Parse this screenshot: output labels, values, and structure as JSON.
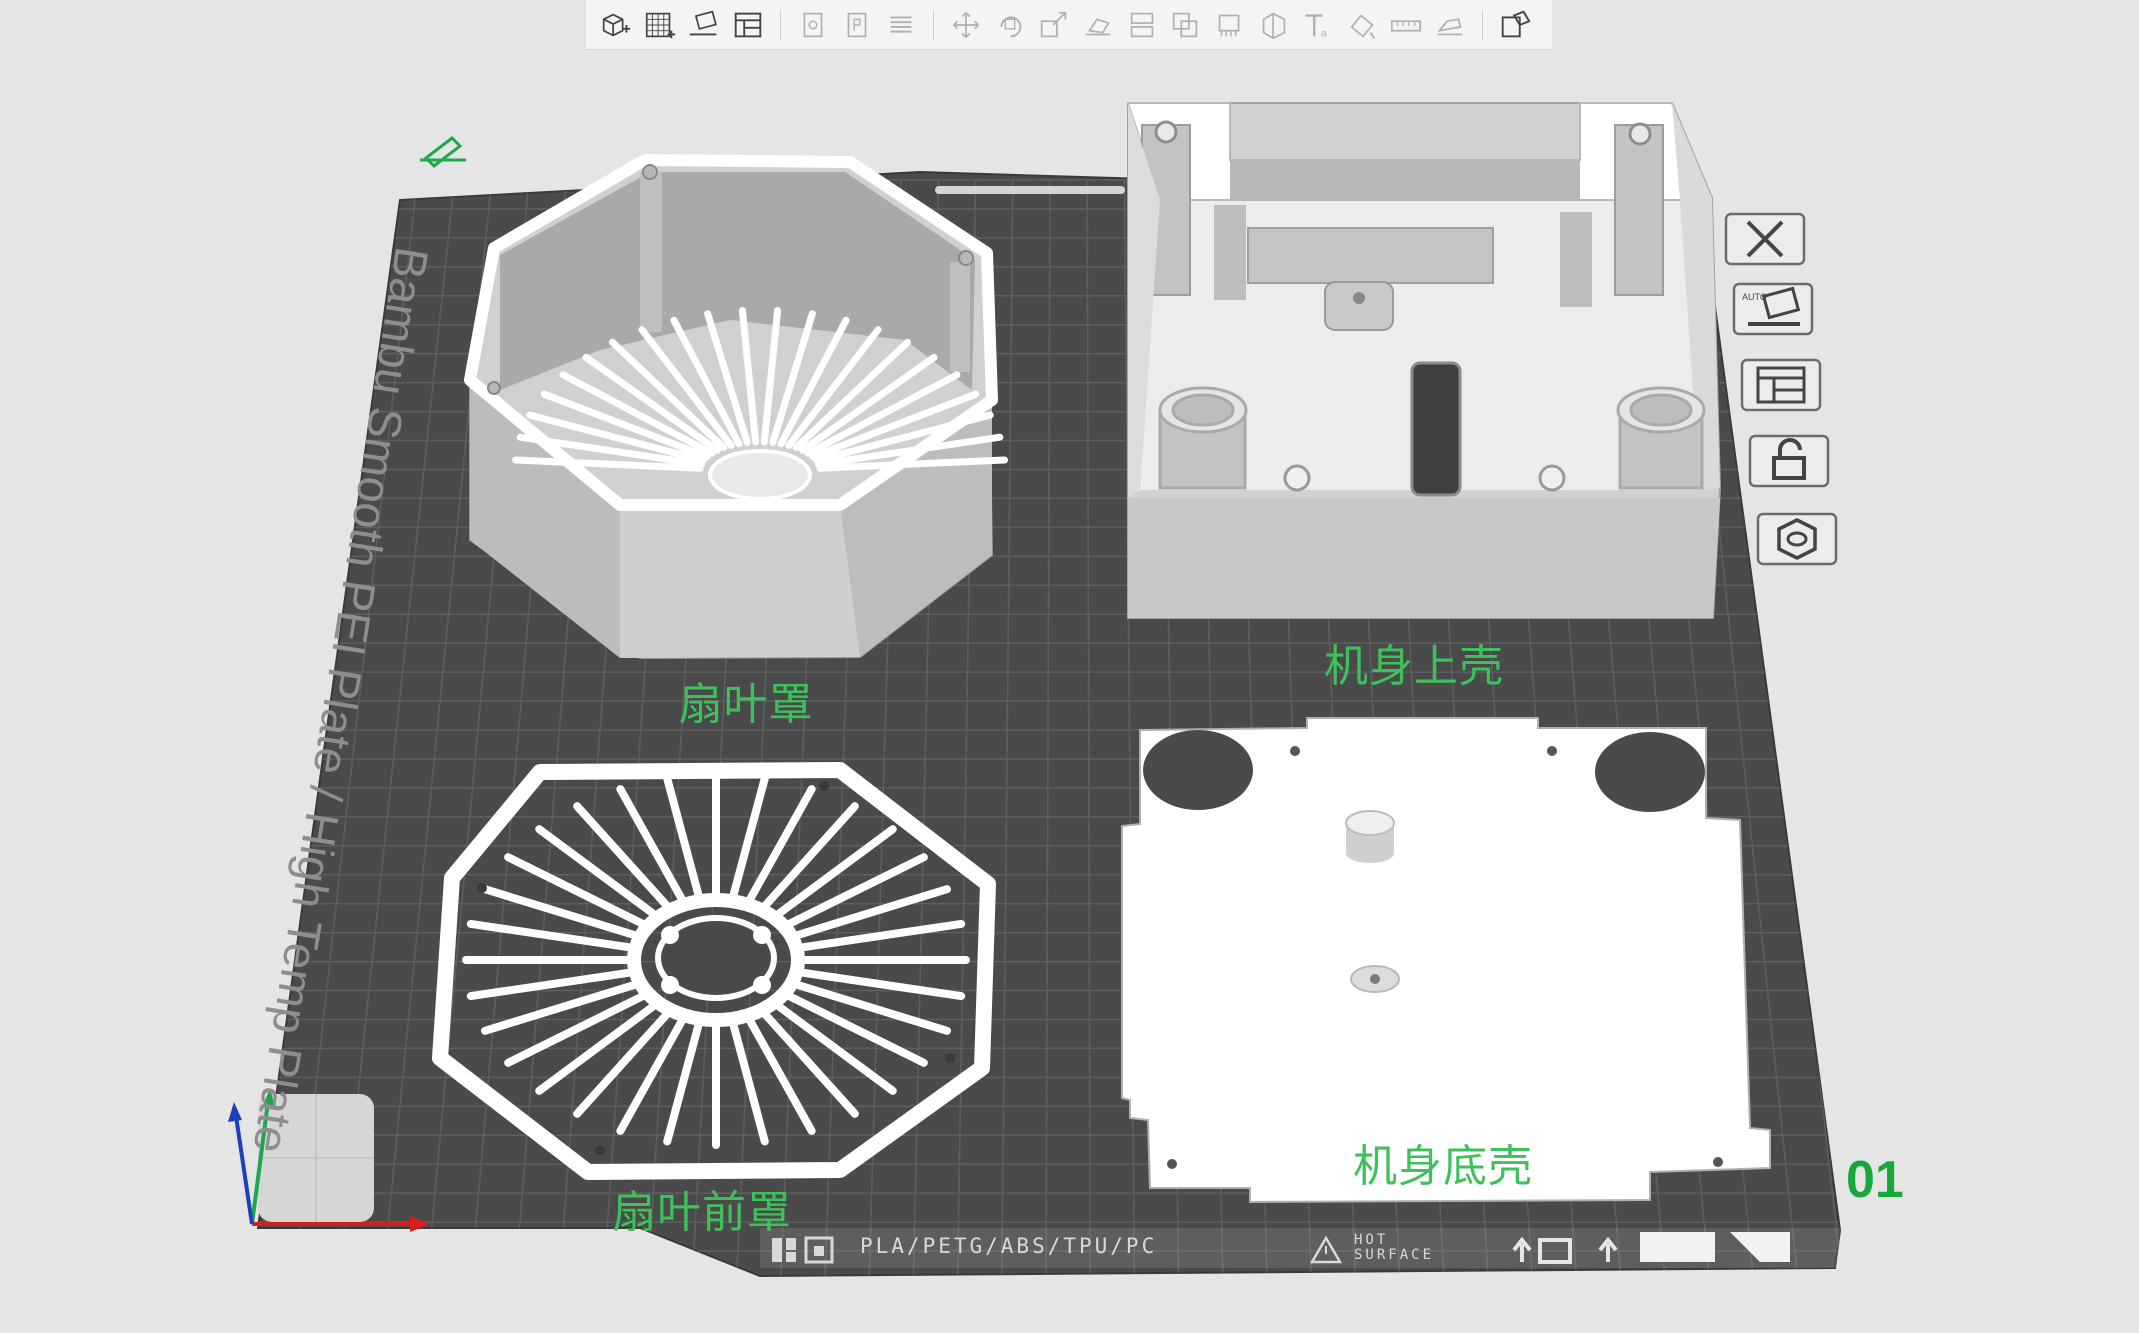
{
  "toolbar": {
    "groups": [
      [
        {
          "icon": "add-cube-icon",
          "label": "Add",
          "enabled": true
        },
        {
          "icon": "add-plate-icon",
          "label": "Add plate",
          "enabled": true
        },
        {
          "icon": "auto-orient-icon",
          "label": "Auto orient",
          "enabled": true
        },
        {
          "icon": "arrange-icon",
          "label": "Arrange",
          "enabled": true
        }
      ],
      [
        {
          "icon": "copy-icon",
          "label": "Copy",
          "enabled": false
        },
        {
          "icon": "paste-icon",
          "label": "Paste",
          "enabled": false
        },
        {
          "icon": "layers-icon",
          "label": "Layers",
          "enabled": false
        }
      ],
      [
        {
          "icon": "move-icon",
          "label": "Move",
          "enabled": false
        },
        {
          "icon": "rotate-icon",
          "label": "Rotate",
          "enabled": false
        },
        {
          "icon": "scale-icon",
          "label": "Scale",
          "enabled": false
        },
        {
          "icon": "lay-on-face-icon",
          "label": "Lay on face",
          "enabled": false
        },
        {
          "icon": "cut-icon",
          "label": "Cut",
          "enabled": false
        },
        {
          "icon": "boolean-icon",
          "label": "Boolean",
          "enabled": false
        },
        {
          "icon": "support-paint-icon",
          "label": "Support painting",
          "enabled": false
        },
        {
          "icon": "seam-paint-icon",
          "label": "Seam painting",
          "enabled": false
        },
        {
          "icon": "text-icon",
          "label": "Text",
          "enabled": false
        },
        {
          "icon": "color-paint-icon",
          "label": "Color painting",
          "enabled": false
        },
        {
          "icon": "measure-icon",
          "label": "Measure",
          "enabled": false
        },
        {
          "icon": "assembly-icon",
          "label": "Assembly",
          "enabled": false
        }
      ],
      [
        {
          "icon": "assembly-view-icon",
          "label": "Assembly view",
          "enabled": true
        }
      ]
    ]
  },
  "plate": {
    "name": "Bambu Smooth PEI Plate / High Temp Plate",
    "number": "01",
    "footer_text": "PLA/PETG/ABS/TPU/PC",
    "hot_surface_line1": "HOT",
    "hot_surface_line2": "SURFACE"
  },
  "objects": [
    {
      "name": "扇叶罩"
    },
    {
      "name": "机身上壳"
    },
    {
      "name": "扇叶前罩"
    },
    {
      "name": "机身底壳"
    }
  ],
  "plate_tools": [
    {
      "icon": "close-icon",
      "label": "Remove plate"
    },
    {
      "icon": "auto-orient-plate-icon",
      "label": "Auto orient"
    },
    {
      "icon": "arrange-plate-icon",
      "label": "Arrange"
    },
    {
      "icon": "unlock-icon",
      "label": "Lock plate"
    },
    {
      "icon": "plate-settings-icon",
      "label": "Plate settings"
    }
  ],
  "colors": {
    "background": "#e5e5e6",
    "plate": "#4a4a4a",
    "grid": "#5e5e5e",
    "model": "#ffffff",
    "model_shade": "#c9c9c9",
    "label": "#3dc15a",
    "plate_number": "#16a83a",
    "axis_x": "#d81e1e",
    "axis_y": "#1fa84a",
    "axis_z": "#1d3fb8"
  }
}
